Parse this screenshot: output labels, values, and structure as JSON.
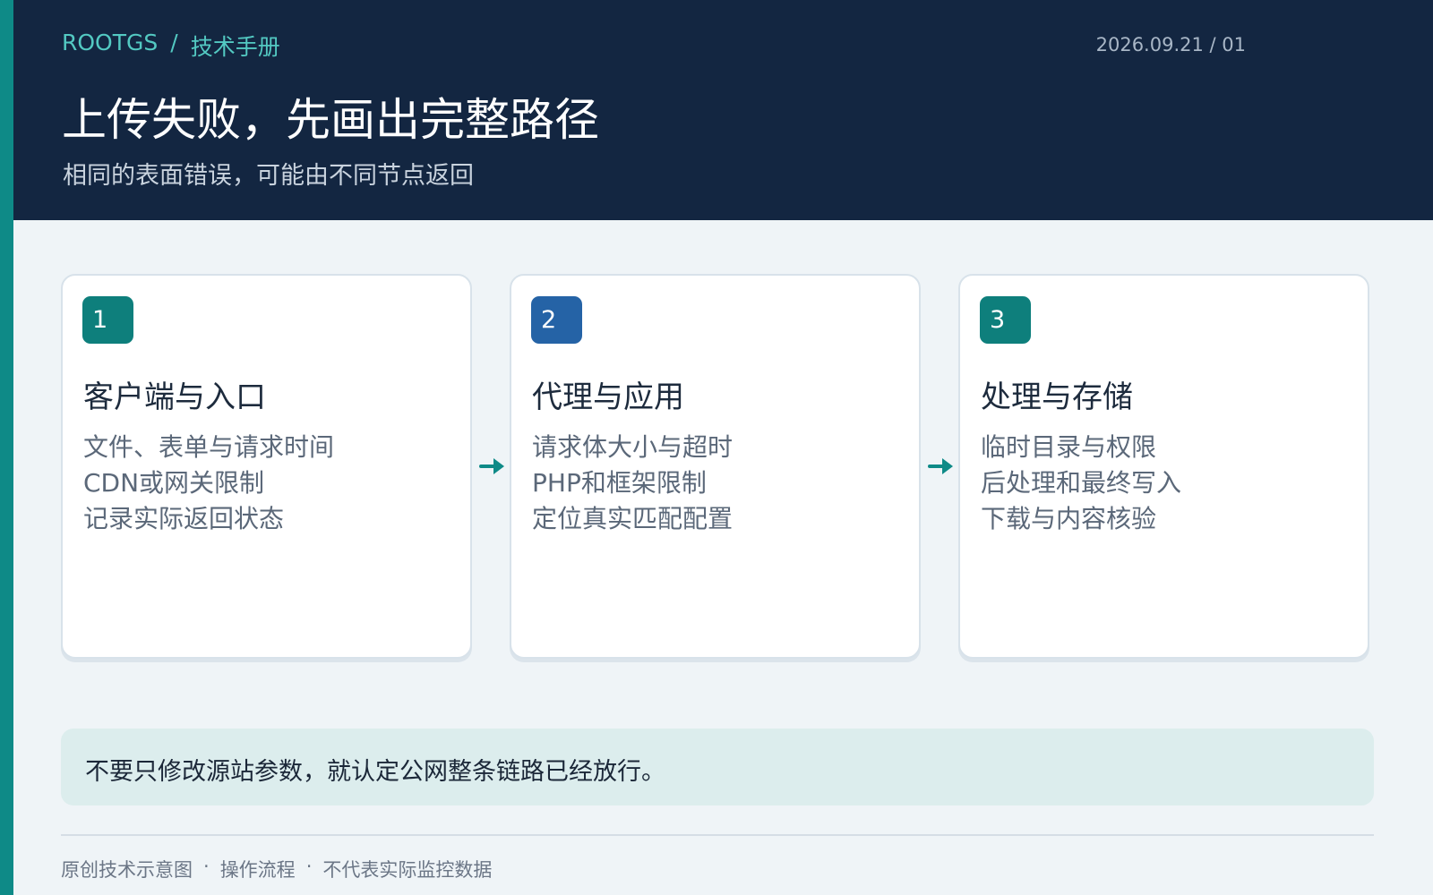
{
  "header": {
    "brand": "ROOTGS",
    "separator": "/",
    "section": "技术手册",
    "date": "2026.09.21 / 01",
    "title": "上传失败，先画出完整路径",
    "subtitle": "相同的表面错误，可能由不同节点返回"
  },
  "steps": [
    {
      "number": "1",
      "title": "客户端与入口",
      "lines": [
        "文件、表单与请求时间",
        "CDN或网关限制",
        "记录实际返回状态"
      ],
      "badge_color": "#0e7f7c"
    },
    {
      "number": "2",
      "title": "代理与应用",
      "lines": [
        "请求体大小与超时",
        "PHP和框架限制",
        "定位真实匹配配置"
      ],
      "badge_color": "#2563a6"
    },
    {
      "number": "3",
      "title": "处理与存储",
      "lines": [
        "临时目录与权限",
        "后处理和最终写入",
        "下载与内容核验"
      ],
      "badge_color": "#0e7f7c"
    }
  ],
  "connectors": {
    "icon": "arrow-right-icon",
    "color": "#0e8a87"
  },
  "note": {
    "text": "不要只修改源站参数，就认定公网整条链路已经放行。"
  },
  "footer": {
    "items": [
      "原创技术示意图",
      "操作流程",
      "不代表实际监控数据"
    ],
    "separator": "·"
  },
  "colors": {
    "accent": "#0e8a87",
    "header_bg": "#132641",
    "page_bg": "#eff4f7",
    "note_bg": "#dceded"
  }
}
